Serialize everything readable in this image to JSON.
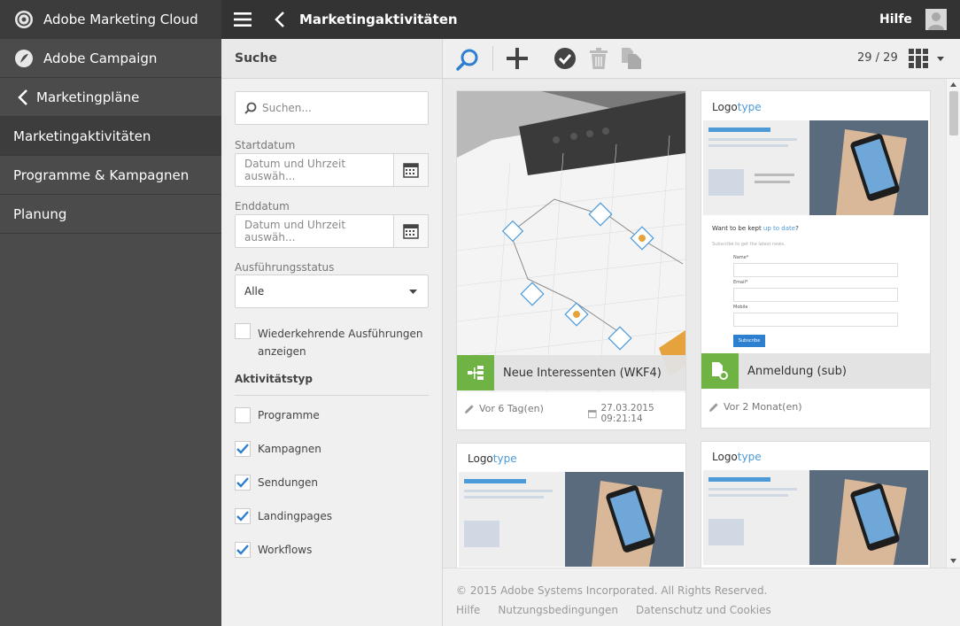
{
  "nav": {
    "items": [
      {
        "label": "Adobe Marketing Cloud",
        "icon": "adobe-marketing-cloud-icon"
      },
      {
        "label": "Adobe Campaign",
        "icon": "adobe-campaign-icon"
      },
      {
        "label": "Marketingpläne",
        "icon": "chevron-left-icon"
      },
      {
        "label": "Marketingaktivitäten"
      },
      {
        "label": "Programme & Kampagnen"
      },
      {
        "label": "Planung"
      }
    ]
  },
  "topbar": {
    "title": "Marketingaktivitäten",
    "help": "Hilfe"
  },
  "filter": {
    "title": "Suche",
    "search_placeholder": "Suchen...",
    "start_label": "Startdatum",
    "start_placeholder": "Datum und Uhrzeit auswäh...",
    "end_label": "Enddatum",
    "end_placeholder": "Datum und Uhrzeit auswäh...",
    "status_label": "Ausführungsstatus",
    "status_value": "Alle",
    "recurring_label": "Wiederkehrende Ausführungen anzeigen",
    "type_heading": "Aktivitätstyp",
    "types": [
      {
        "label": "Programme",
        "checked": false
      },
      {
        "label": "Kampagnen",
        "checked": true
      },
      {
        "label": "Sendungen",
        "checked": true
      },
      {
        "label": "Landingpages",
        "checked": true
      },
      {
        "label": "Workflows",
        "checked": true
      }
    ]
  },
  "toolbar": {
    "count": "29 / 29"
  },
  "cards": [
    {
      "title": "Neue Interessenten (WKF4)",
      "modified": "Vor 6 Tag(en)",
      "date": "27.03.2015 09:21:14",
      "icon": "workflow-icon"
    },
    {
      "title": "Anmeldung (sub)",
      "modified": "Vor 2 Monat(en)",
      "date": "",
      "icon": "landing-page-icon"
    },
    {
      "title": "",
      "logo": "Logotype"
    },
    {
      "title": "",
      "logo": "Logotype"
    }
  ],
  "landing": {
    "logo_a": "Logo",
    "logo_b": "type",
    "question_a": "Want to be kept ",
    "question_link": "up to date",
    "question_b": "?",
    "subtitle": "Subscribe to get the latest news.",
    "name": "Name*",
    "email": "Email*",
    "mobile": "Mobile",
    "button": "Subscribe"
  },
  "footer": {
    "copyright": "© 2015 Adobe Systems Incorporated. All Rights Reserved.",
    "links": [
      "Hilfe",
      "Nutzungsbedingungen",
      "Datenschutz und Cookies"
    ]
  },
  "colors": {
    "accent": "#2d7fd0",
    "green": "#6eb344",
    "nav": "#4b4b4b",
    "topbar": "#333333"
  }
}
